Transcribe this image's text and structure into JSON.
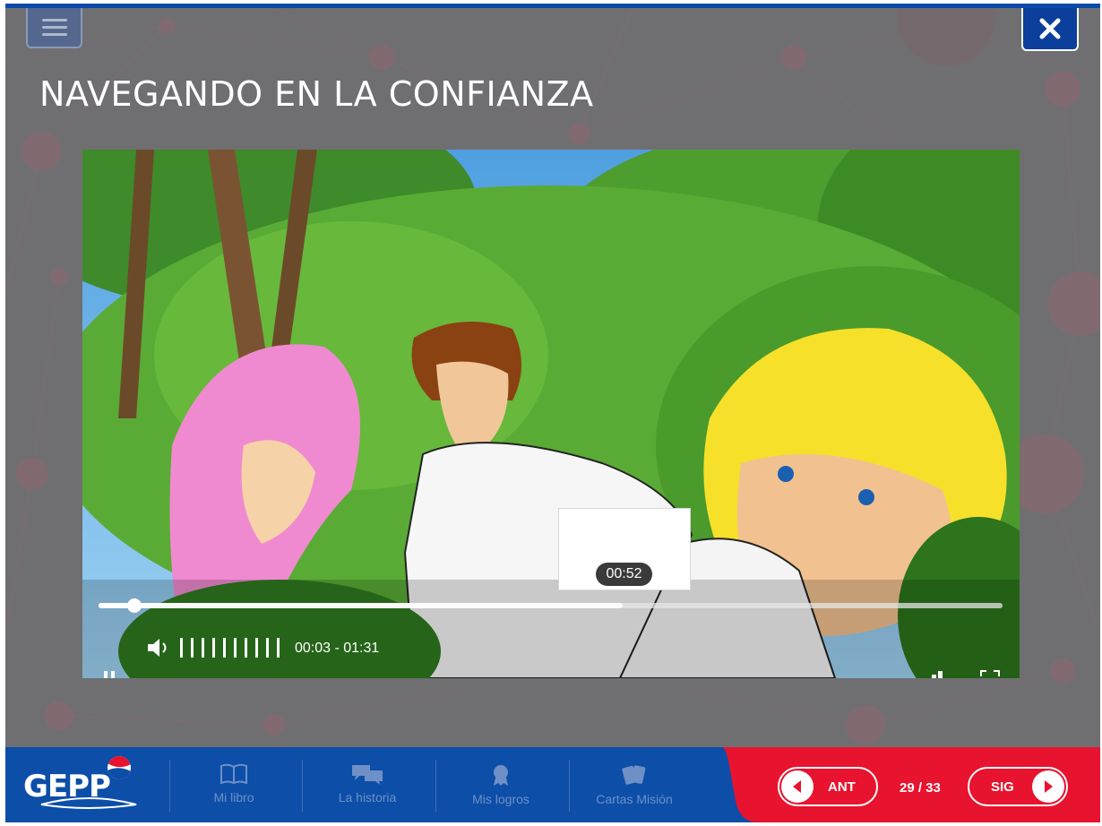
{
  "header": {
    "title": "NAVEGANDO EN LA CONFIANZA"
  },
  "video": {
    "hover_time": "00:52",
    "time_display": "00:03 - 01:31",
    "progress": 0.04,
    "buffered": 0.58,
    "volume_levels": 10
  },
  "footer": {
    "logo_text": "GEPP",
    "nav": [
      {
        "label": "Mi libro",
        "icon": "book-icon"
      },
      {
        "label": "La historia",
        "icon": "chat-bubbles-icon"
      },
      {
        "label": "Mis logros",
        "icon": "medal-icon"
      },
      {
        "label": "Cartas Misión",
        "icon": "cards-icon"
      }
    ],
    "prev_label": "ANT",
    "next_label": "SIG",
    "page_counter": "29 / 33"
  },
  "colors": {
    "brand_blue": "#0c4ea8",
    "accent_red": "#e8132e",
    "stage_gray": "#6f6f72"
  }
}
